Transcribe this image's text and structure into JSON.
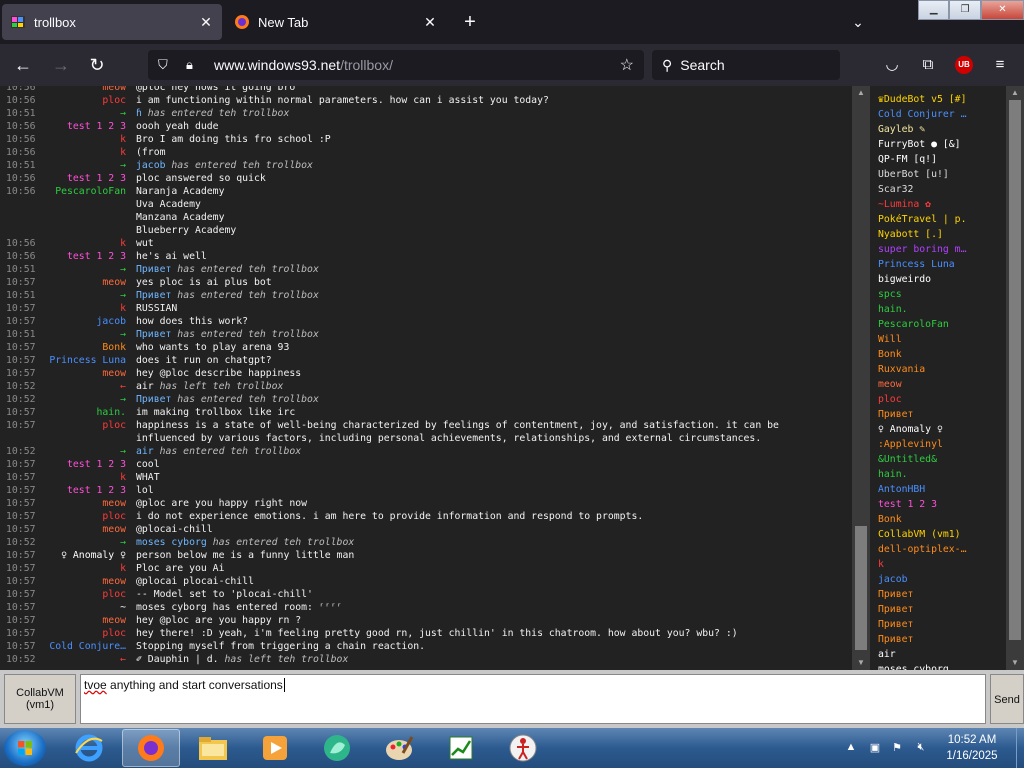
{
  "browser": {
    "tabs": [
      {
        "title": "trollbox",
        "active": true,
        "icon": "windows93-icon"
      },
      {
        "title": "New Tab",
        "active": false,
        "icon": "firefox-icon"
      }
    ],
    "url_host": "www.windows93.net",
    "url_path": "/trollbox/",
    "search_placeholder": "Search",
    "ublock_label": "UB"
  },
  "chat": {
    "messages": [
      {
        "time": "10:56",
        "nick": "meow",
        "nick_color": "#ff6a3d",
        "text": "@ploc hey hows it going bro",
        "sys": ""
      },
      {
        "time": "10:56",
        "nick": "ploc",
        "nick_color": "#ff3b3b",
        "text": "i am functioning within normal parameters. how can i assist you today?",
        "sys": ""
      },
      {
        "time": "10:51",
        "nick": "→",
        "nick_color": "#2ecc40",
        "text": "ɦ ",
        "sys": "has entered teh trollbox"
      },
      {
        "time": "10:56",
        "nick": "test 1 2 3",
        "nick_color": "#ff4fd8",
        "text": "oooh yeah dude",
        "sys": ""
      },
      {
        "time": "10:56",
        "nick": "k",
        "nick_color": "#ff3b3b",
        "text": "Bro I am doing this fro school :P",
        "sys": ""
      },
      {
        "time": "10:56",
        "nick": "k",
        "nick_color": "#ff3b3b",
        "text": "(from",
        "sys": ""
      },
      {
        "time": "10:51",
        "nick": "→",
        "nick_color": "#2ecc40",
        "text": "jacob ",
        "sys": "has entered teh trollbox"
      },
      {
        "time": "10:56",
        "nick": "test 1 2 3",
        "nick_color": "#ff4fd8",
        "text": "ploc answered so quick",
        "sys": ""
      },
      {
        "time": "10:56",
        "nick": "PescaroloFan",
        "nick_color": "#2ecc40",
        "text": "Naranja Academy",
        "sys": ""
      },
      {
        "time": "",
        "nick": "",
        "nick_color": "#ffffff",
        "text": "Uva Academy",
        "sys": ""
      },
      {
        "time": "",
        "nick": "",
        "nick_color": "#ffffff",
        "text": "Manzana Academy",
        "sys": ""
      },
      {
        "time": "",
        "nick": "",
        "nick_color": "#ffffff",
        "text": "Blueberry Academy",
        "sys": ""
      },
      {
        "time": "10:56",
        "nick": "k",
        "nick_color": "#ff3b3b",
        "text": "wut",
        "sys": ""
      },
      {
        "time": "10:56",
        "nick": "test 1 2 3",
        "nick_color": "#ff4fd8",
        "text": "he's ai well",
        "sys": ""
      },
      {
        "time": "10:51",
        "nick": "→",
        "nick_color": "#2ecc40",
        "text": "Привет ",
        "sys": "has entered teh trollbox"
      },
      {
        "time": "10:57",
        "nick": "meow",
        "nick_color": "#ff6a3d",
        "text": "yes ploc is ai plus bot",
        "sys": ""
      },
      {
        "time": "10:51",
        "nick": "→",
        "nick_color": "#2ecc40",
        "text": "Привет ",
        "sys": "has entered teh trollbox"
      },
      {
        "time": "10:57",
        "nick": "k",
        "nick_color": "#ff3b3b",
        "text": "RUSSIAN",
        "sys": ""
      },
      {
        "time": "10:57",
        "nick": "jacob",
        "nick_color": "#4a90ff",
        "text": "how does this work?",
        "sys": ""
      },
      {
        "time": "10:51",
        "nick": "→",
        "nick_color": "#2ecc40",
        "text": "Привет ",
        "sys": "has entered teh trollbox"
      },
      {
        "time": "10:57",
        "nick": "Bonk",
        "nick_color": "#ff8c1a",
        "text": "who wants to play arena 93",
        "sys": ""
      },
      {
        "time": "10:57",
        "nick": "Princess Luna",
        "nick_color": "#4a90ff",
        "text": "does it run on chatgpt?",
        "sys": ""
      },
      {
        "time": "10:57",
        "nick": "meow",
        "nick_color": "#ff6a3d",
        "text": "hey @ploc describe happiness",
        "sys": ""
      },
      {
        "time": "10:52",
        "nick": "←",
        "nick_color": "#ff3b3b",
        "text": "air ",
        "sys": "has left teh trollbox"
      },
      {
        "time": "10:52",
        "nick": "→",
        "nick_color": "#2ecc40",
        "text": "Привет ",
        "sys": "has entered teh trollbox"
      },
      {
        "time": "10:57",
        "nick": "hain.",
        "nick_color": "#2ecc40",
        "text": "im making trollbox like irc",
        "sys": ""
      },
      {
        "time": "10:57",
        "nick": "ploc",
        "nick_color": "#ff3b3b",
        "text": "happiness is a state of well-being characterized by feelings of contentment, joy, and satisfaction. it can be",
        "sys": ""
      },
      {
        "time": "",
        "nick": "",
        "nick_color": "#ffffff",
        "text": "influenced by various factors, including personal achievements, relationships, and external circumstances.",
        "sys": ""
      },
      {
        "time": "10:52",
        "nick": "→",
        "nick_color": "#2ecc40",
        "text": "air ",
        "sys": "has entered teh trollbox"
      },
      {
        "time": "10:57",
        "nick": "test 1 2 3",
        "nick_color": "#ff4fd8",
        "text": "cool",
        "sys": ""
      },
      {
        "time": "10:57",
        "nick": "k",
        "nick_color": "#ff3b3b",
        "text": "WHAT",
        "sys": ""
      },
      {
        "time": "10:57",
        "nick": "test 1 2 3",
        "nick_color": "#ff4fd8",
        "text": "lol",
        "sys": ""
      },
      {
        "time": "10:57",
        "nick": "meow",
        "nick_color": "#ff6a3d",
        "text": "@ploc are you happy right now",
        "sys": ""
      },
      {
        "time": "10:57",
        "nick": "ploc",
        "nick_color": "#ff3b3b",
        "text": "i do not experience emotions. i am here to provide information and respond to prompts.",
        "sys": ""
      },
      {
        "time": "10:57",
        "nick": "meow",
        "nick_color": "#ff6a3d",
        "text": "@plocai-chill",
        "sys": ""
      },
      {
        "time": "10:52",
        "nick": "→",
        "nick_color": "#2ecc40",
        "text": "moses cyborg ",
        "sys": "has entered teh trollbox"
      },
      {
        "time": "10:57",
        "nick": "♀ Anomaly ♀",
        "nick_color": "#ffffff",
        "text": "person below me is a funny little man",
        "sys": ""
      },
      {
        "time": "10:57",
        "nick": "k",
        "nick_color": "#ff3b3b",
        "text": "Ploc are you Ai",
        "sys": ""
      },
      {
        "time": "10:57",
        "nick": "meow",
        "nick_color": "#ff6a3d",
        "text": "@plocai plocai-chill",
        "sys": ""
      },
      {
        "time": "10:57",
        "nick": "ploc",
        "nick_color": "#ff3b3b",
        "text": "-- Model set to 'plocai-chill'",
        "sys": ""
      },
      {
        "time": "10:57",
        "nick": "~",
        "nick_color": "#ffffff",
        "text": "moses cyborg has entered room: ʳʳʳʳ",
        "sys": ""
      },
      {
        "time": "10:57",
        "nick": "meow",
        "nick_color": "#ff6a3d",
        "text": "hey @ploc are you happy rn ?",
        "sys": ""
      },
      {
        "time": "10:57",
        "nick": "ploc",
        "nick_color": "#ff3b3b",
        "text": "hey there! :D yeah, i'm feeling pretty good rn, just chillin' in this chatroom. how about you? wbu? :)",
        "sys": ""
      },
      {
        "time": "10:57",
        "nick": "Cold Conjure…",
        "nick_color": "#4a90ff",
        "text": "Stopping myself from triggering a chain reaction.",
        "sys": ""
      },
      {
        "time": "10:52",
        "nick": "←",
        "nick_color": "#ff3b3b",
        "text": "✐ Dauphin | d. ",
        "sys": "has left teh trollbox"
      }
    ]
  },
  "users": [
    {
      "name": "♛DudeBot v5 [#]",
      "color": "#ffd400"
    },
    {
      "name": "Cold Conjurer …",
      "color": "#4a90ff"
    },
    {
      "name": "Gayleb ✎",
      "color": "#f2e6a0"
    },
    {
      "name": "FurryBot ● [&]",
      "color": "#ffffff"
    },
    {
      "name": "QP-FM [q!]",
      "color": "#ffffff"
    },
    {
      "name": "UberBot [u!]",
      "color": "#dddddd"
    },
    {
      "name": "Scar32",
      "color": "#dddddd"
    },
    {
      "name": "~Lumina ✿",
      "color": "#ff3b3b"
    },
    {
      "name": "PokéTravel | p.",
      "color": "#ffd400"
    },
    {
      "name": "Nyabott [.]",
      "color": "#ffd400"
    },
    {
      "name": "super boring m…",
      "color": "#b040ff"
    },
    {
      "name": "Princess Luna",
      "color": "#4a90ff"
    },
    {
      "name": "bigweirdo",
      "color": "#ffffff"
    },
    {
      "name": "spcs",
      "color": "#2ecc40"
    },
    {
      "name": "hain.",
      "color": "#2ecc40"
    },
    {
      "name": "PescaroloFan",
      "color": "#2ecc40"
    },
    {
      "name": "Will",
      "color": "#ff8c1a"
    },
    {
      "name": "Bonk",
      "color": "#ff8c1a"
    },
    {
      "name": "Ruxvania",
      "color": "#ff8c1a"
    },
    {
      "name": "meow",
      "color": "#ff6a3d"
    },
    {
      "name": "ploc",
      "color": "#ff3b3b"
    },
    {
      "name": "Привет",
      "color": "#ff8c1a"
    },
    {
      "name": "♀ Anomaly ♀",
      "color": "#ffffff"
    },
    {
      "name": ":Applevinyl",
      "color": "#ff8c1a"
    },
    {
      "name": "&Untitled&",
      "color": "#2ecc40"
    },
    {
      "name": "hain.",
      "color": "#2ecc40"
    },
    {
      "name": "AntonHBH",
      "color": "#4a90ff"
    },
    {
      "name": "test 1 2 3",
      "color": "#ff4fd8"
    },
    {
      "name": "Bonk",
      "color": "#ff8c1a"
    },
    {
      "name": "CollabVM (vm1)",
      "color": "#ffd400"
    },
    {
      "name": "dell-optiplex-…",
      "color": "#ff8c1a"
    },
    {
      "name": "k",
      "color": "#ff3b3b"
    },
    {
      "name": "jacob",
      "color": "#4a90ff"
    },
    {
      "name": "Привет",
      "color": "#ff8c1a"
    },
    {
      "name": "Привет",
      "color": "#ff8c1a"
    },
    {
      "name": "Привет",
      "color": "#ff8c1a"
    },
    {
      "name": "Привет",
      "color": "#ff8c1a"
    },
    {
      "name": "air",
      "color": "#ffffff"
    },
    {
      "name": "moses cyborg",
      "color": "#ffffff"
    }
  ],
  "input": {
    "nick_line1": "CollabVM",
    "nick_line2": "(vm1)",
    "first_word": "tvoe",
    "rest": " anything and start conversations",
    "send_label": "Send"
  },
  "taskbar": {
    "apps": [
      "ie-icon",
      "firefox-icon",
      "explorer-icon",
      "media-player-icon",
      "chat-icon",
      "paint-icon",
      "chart-icon",
      "stickman-icon"
    ],
    "time": "10:52 AM",
    "date": "1/16/2025"
  }
}
